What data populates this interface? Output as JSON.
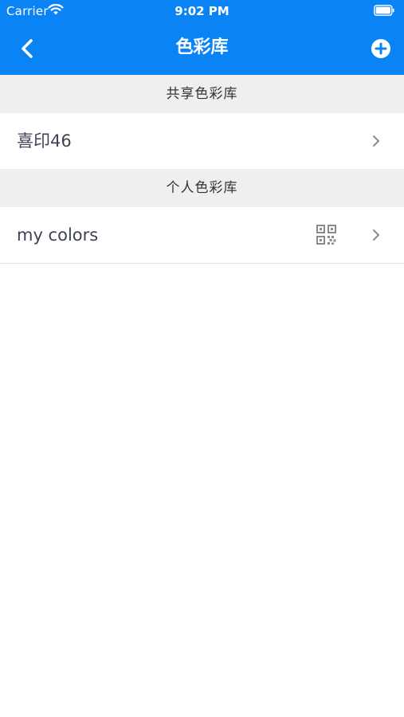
{
  "status_bar": {
    "carrier": "Carrier",
    "time": "9:02 PM"
  },
  "nav": {
    "title": "色彩库",
    "back_icon": "chevron-left-icon",
    "add_icon": "plus-circle-icon"
  },
  "sections": [
    {
      "header": "共享色彩库",
      "items": [
        {
          "label": "喜印46",
          "has_qr": false
        }
      ]
    },
    {
      "header": "个人色彩库",
      "items": [
        {
          "label": "my colors",
          "has_qr": true
        }
      ]
    }
  ],
  "colors": {
    "accent": "#0a84f5",
    "section_bg": "#efefef",
    "row_text": "#3d4354",
    "icon_gray": "#8a8a8a"
  }
}
